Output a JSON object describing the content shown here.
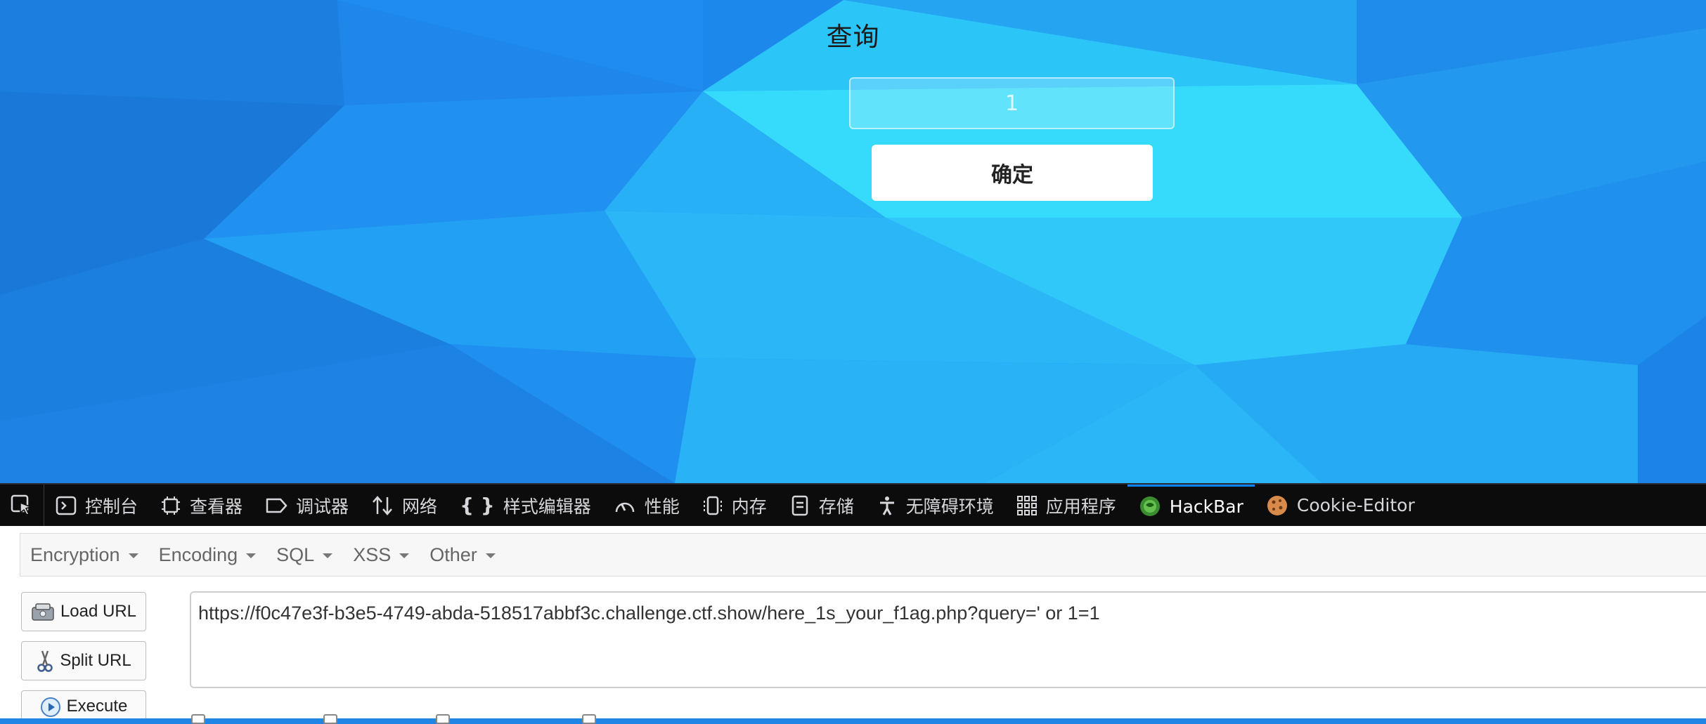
{
  "page": {
    "title": "查询",
    "input_placeholder": "1",
    "confirm_label": "确定"
  },
  "devtools": {
    "tabs": [
      {
        "label": "控制台",
        "icon": "console-icon"
      },
      {
        "label": "查看器",
        "icon": "inspector-icon"
      },
      {
        "label": "调试器",
        "icon": "debugger-icon"
      },
      {
        "label": "网络",
        "icon": "network-icon"
      },
      {
        "label": "样式编辑器",
        "icon": "style-editor-icon"
      },
      {
        "label": "性能",
        "icon": "performance-icon"
      },
      {
        "label": "内存",
        "icon": "memory-icon"
      },
      {
        "label": "存储",
        "icon": "storage-icon"
      },
      {
        "label": "无障碍环境",
        "icon": "accessibility-icon"
      },
      {
        "label": "应用程序",
        "icon": "application-icon"
      },
      {
        "label": "HackBar",
        "icon": "hackbar-icon",
        "active": true
      },
      {
        "label": "Cookie-Editor",
        "icon": "cookie-icon"
      }
    ]
  },
  "hackbar": {
    "menu": [
      "Encryption",
      "Encoding",
      "SQL",
      "XSS",
      "Other"
    ],
    "load_url": "Load URL",
    "split_url": "Split URL",
    "execute": "Execute",
    "url": "https://f0c47e3f-b3e5-4749-abda-518517abbf3c.challenge.ctf.show/here_1s_your_f1ag.php?query=' or 1=1"
  },
  "colors": {
    "page_bg": "#1d8aef",
    "devtools_bg": "#0c0c0d",
    "active_tab_accent": "#0a84ff"
  }
}
